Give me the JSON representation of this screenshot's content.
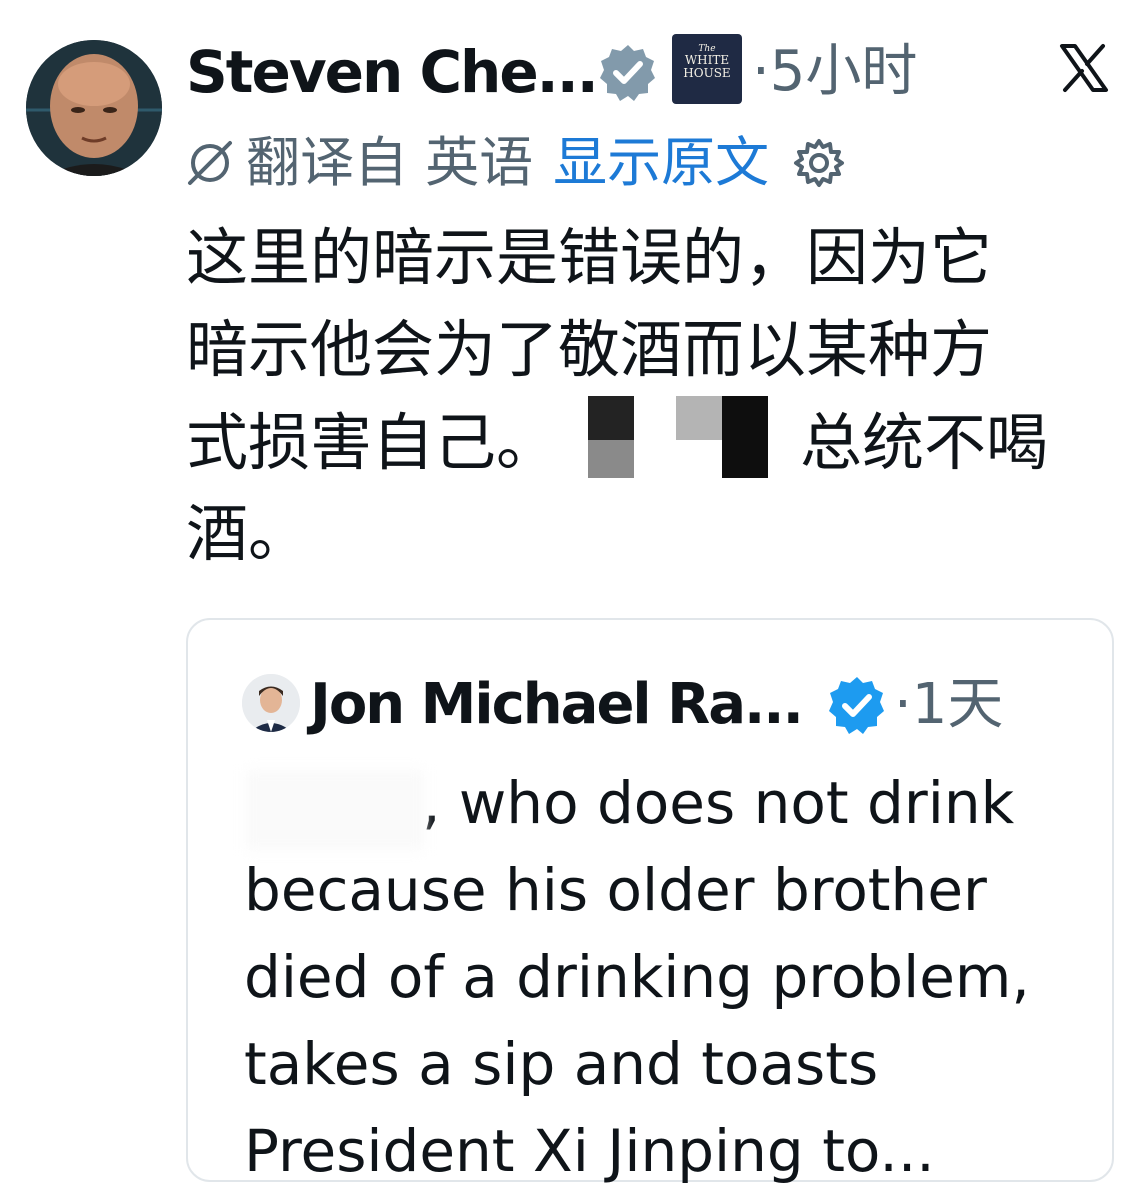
{
  "tweet": {
    "author_name": "Steven Che...",
    "affiliation_badge": {
      "line1": "The",
      "line2": "WHITE",
      "line3": "HOUSE"
    },
    "time": "·5小时",
    "translation": {
      "translated_from": "翻译自 英语",
      "show_original": "显示原文"
    },
    "text_lines": [
      "这里的暗示是错误的，因为它",
      "暗示他会为了敬酒而以某种方",
      "式损害自己。",
      "总统不喝",
      "酒。"
    ]
  },
  "quoted_tweet": {
    "author_name": "Jon Michael Ra...",
    "time": "·1天",
    "text_lines": [
      ", who does not drink",
      "because his older brother",
      "died of a drinking problem,",
      "takes a sip and toasts",
      "President Xi Jinping to..."
    ]
  },
  "colors": {
    "text_primary": "#0f1419",
    "text_secondary": "#536471",
    "link_blue": "#1d7ad6",
    "verified_blue": "#1d9bf0",
    "verified_gray": "#829aab",
    "white_house_badge": "#1f2a44"
  },
  "icons": [
    "verified-gray-icon",
    "white-house-badge",
    "x-logo-icon",
    "translate-off-icon",
    "gear-icon",
    "verified-blue-icon"
  ]
}
